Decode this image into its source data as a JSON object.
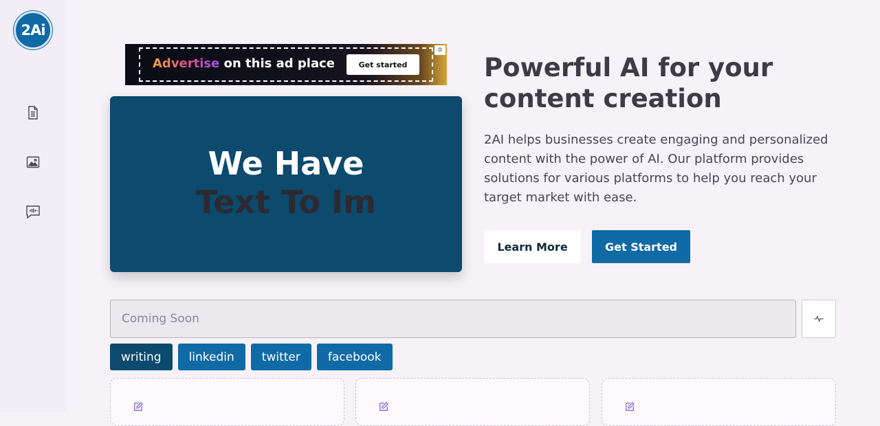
{
  "sidebar": {
    "logo_text": "2Ai",
    "items": [
      {
        "icon": "document-icon"
      },
      {
        "icon": "image-icon"
      },
      {
        "icon": "chat-audio-icon"
      }
    ]
  },
  "ad": {
    "highlight": "Advertise",
    "text": " on this ad place",
    "button_label": "Get started",
    "badge": "♔"
  },
  "hero": {
    "line1": "We Have",
    "line2": "Text To Im"
  },
  "intro": {
    "headline": "Powerful AI for your content creation",
    "description": "2AI helps businesses create engaging and personalized content with the power of AI. Our platform provides solutions for various platforms to help you reach your target market with ease.",
    "learn_more_label": "Learn More",
    "get_started_label": "Get Started"
  },
  "search": {
    "placeholder": "Coming Soon",
    "value": ""
  },
  "tags": [
    {
      "label": "writing",
      "active": true
    },
    {
      "label": "linkedin",
      "active": false
    },
    {
      "label": "twitter",
      "active": false
    },
    {
      "label": "facebook",
      "active": false
    }
  ],
  "colors": {
    "primary": "#0f6aa6",
    "dark_primary": "#0c4a6e",
    "background": "#f6f2f8",
    "sidebar": "#f1eef7"
  }
}
